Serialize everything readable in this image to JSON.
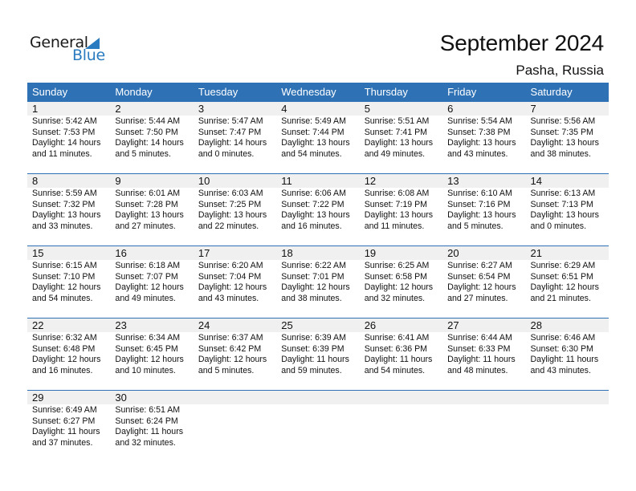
{
  "logo": {
    "general": "General",
    "blue": "Blue"
  },
  "header": {
    "title": "September 2024",
    "location": "Pasha, Russia"
  },
  "weekdays": [
    "Sunday",
    "Monday",
    "Tuesday",
    "Wednesday",
    "Thursday",
    "Friday",
    "Saturday"
  ],
  "weeks": [
    [
      {
        "day": "1",
        "sunrise": "Sunrise: 5:42 AM",
        "sunset": "Sunset: 7:53 PM",
        "daylight1": "Daylight: 14 hours",
        "daylight2": "and 11 minutes."
      },
      {
        "day": "2",
        "sunrise": "Sunrise: 5:44 AM",
        "sunset": "Sunset: 7:50 PM",
        "daylight1": "Daylight: 14 hours",
        "daylight2": "and 5 minutes."
      },
      {
        "day": "3",
        "sunrise": "Sunrise: 5:47 AM",
        "sunset": "Sunset: 7:47 PM",
        "daylight1": "Daylight: 14 hours",
        "daylight2": "and 0 minutes."
      },
      {
        "day": "4",
        "sunrise": "Sunrise: 5:49 AM",
        "sunset": "Sunset: 7:44 PM",
        "daylight1": "Daylight: 13 hours",
        "daylight2": "and 54 minutes."
      },
      {
        "day": "5",
        "sunrise": "Sunrise: 5:51 AM",
        "sunset": "Sunset: 7:41 PM",
        "daylight1": "Daylight: 13 hours",
        "daylight2": "and 49 minutes."
      },
      {
        "day": "6",
        "sunrise": "Sunrise: 5:54 AM",
        "sunset": "Sunset: 7:38 PM",
        "daylight1": "Daylight: 13 hours",
        "daylight2": "and 43 minutes."
      },
      {
        "day": "7",
        "sunrise": "Sunrise: 5:56 AM",
        "sunset": "Sunset: 7:35 PM",
        "daylight1": "Daylight: 13 hours",
        "daylight2": "and 38 minutes."
      }
    ],
    [
      {
        "day": "8",
        "sunrise": "Sunrise: 5:59 AM",
        "sunset": "Sunset: 7:32 PM",
        "daylight1": "Daylight: 13 hours",
        "daylight2": "and 33 minutes."
      },
      {
        "day": "9",
        "sunrise": "Sunrise: 6:01 AM",
        "sunset": "Sunset: 7:28 PM",
        "daylight1": "Daylight: 13 hours",
        "daylight2": "and 27 minutes."
      },
      {
        "day": "10",
        "sunrise": "Sunrise: 6:03 AM",
        "sunset": "Sunset: 7:25 PM",
        "daylight1": "Daylight: 13 hours",
        "daylight2": "and 22 minutes."
      },
      {
        "day": "11",
        "sunrise": "Sunrise: 6:06 AM",
        "sunset": "Sunset: 7:22 PM",
        "daylight1": "Daylight: 13 hours",
        "daylight2": "and 16 minutes."
      },
      {
        "day": "12",
        "sunrise": "Sunrise: 6:08 AM",
        "sunset": "Sunset: 7:19 PM",
        "daylight1": "Daylight: 13 hours",
        "daylight2": "and 11 minutes."
      },
      {
        "day": "13",
        "sunrise": "Sunrise: 6:10 AM",
        "sunset": "Sunset: 7:16 PM",
        "daylight1": "Daylight: 13 hours",
        "daylight2": "and 5 minutes."
      },
      {
        "day": "14",
        "sunrise": "Sunrise: 6:13 AM",
        "sunset": "Sunset: 7:13 PM",
        "daylight1": "Daylight: 13 hours",
        "daylight2": "and 0 minutes."
      }
    ],
    [
      {
        "day": "15",
        "sunrise": "Sunrise: 6:15 AM",
        "sunset": "Sunset: 7:10 PM",
        "daylight1": "Daylight: 12 hours",
        "daylight2": "and 54 minutes."
      },
      {
        "day": "16",
        "sunrise": "Sunrise: 6:18 AM",
        "sunset": "Sunset: 7:07 PM",
        "daylight1": "Daylight: 12 hours",
        "daylight2": "and 49 minutes."
      },
      {
        "day": "17",
        "sunrise": "Sunrise: 6:20 AM",
        "sunset": "Sunset: 7:04 PM",
        "daylight1": "Daylight: 12 hours",
        "daylight2": "and 43 minutes."
      },
      {
        "day": "18",
        "sunrise": "Sunrise: 6:22 AM",
        "sunset": "Sunset: 7:01 PM",
        "daylight1": "Daylight: 12 hours",
        "daylight2": "and 38 minutes."
      },
      {
        "day": "19",
        "sunrise": "Sunrise: 6:25 AM",
        "sunset": "Sunset: 6:58 PM",
        "daylight1": "Daylight: 12 hours",
        "daylight2": "and 32 minutes."
      },
      {
        "day": "20",
        "sunrise": "Sunrise: 6:27 AM",
        "sunset": "Sunset: 6:54 PM",
        "daylight1": "Daylight: 12 hours",
        "daylight2": "and 27 minutes."
      },
      {
        "day": "21",
        "sunrise": "Sunrise: 6:29 AM",
        "sunset": "Sunset: 6:51 PM",
        "daylight1": "Daylight: 12 hours",
        "daylight2": "and 21 minutes."
      }
    ],
    [
      {
        "day": "22",
        "sunrise": "Sunrise: 6:32 AM",
        "sunset": "Sunset: 6:48 PM",
        "daylight1": "Daylight: 12 hours",
        "daylight2": "and 16 minutes."
      },
      {
        "day": "23",
        "sunrise": "Sunrise: 6:34 AM",
        "sunset": "Sunset: 6:45 PM",
        "daylight1": "Daylight: 12 hours",
        "daylight2": "and 10 minutes."
      },
      {
        "day": "24",
        "sunrise": "Sunrise: 6:37 AM",
        "sunset": "Sunset: 6:42 PM",
        "daylight1": "Daylight: 12 hours",
        "daylight2": "and 5 minutes."
      },
      {
        "day": "25",
        "sunrise": "Sunrise: 6:39 AM",
        "sunset": "Sunset: 6:39 PM",
        "daylight1": "Daylight: 11 hours",
        "daylight2": "and 59 minutes."
      },
      {
        "day": "26",
        "sunrise": "Sunrise: 6:41 AM",
        "sunset": "Sunset: 6:36 PM",
        "daylight1": "Daylight: 11 hours",
        "daylight2": "and 54 minutes."
      },
      {
        "day": "27",
        "sunrise": "Sunrise: 6:44 AM",
        "sunset": "Sunset: 6:33 PM",
        "daylight1": "Daylight: 11 hours",
        "daylight2": "and 48 minutes."
      },
      {
        "day": "28",
        "sunrise": "Sunrise: 6:46 AM",
        "sunset": "Sunset: 6:30 PM",
        "daylight1": "Daylight: 11 hours",
        "daylight2": "and 43 minutes."
      }
    ],
    [
      {
        "day": "29",
        "sunrise": "Sunrise: 6:49 AM",
        "sunset": "Sunset: 6:27 PM",
        "daylight1": "Daylight: 11 hours",
        "daylight2": "and 37 minutes."
      },
      {
        "day": "30",
        "sunrise": "Sunrise: 6:51 AM",
        "sunset": "Sunset: 6:24 PM",
        "daylight1": "Daylight: 11 hours",
        "daylight2": "and 32 minutes."
      },
      {
        "day": "",
        "sunrise": "",
        "sunset": "",
        "daylight1": "",
        "daylight2": ""
      },
      {
        "day": "",
        "sunrise": "",
        "sunset": "",
        "daylight1": "",
        "daylight2": ""
      },
      {
        "day": "",
        "sunrise": "",
        "sunset": "",
        "daylight1": "",
        "daylight2": ""
      },
      {
        "day": "",
        "sunrise": "",
        "sunset": "",
        "daylight1": "",
        "daylight2": ""
      },
      {
        "day": "",
        "sunrise": "",
        "sunset": "",
        "daylight1": "",
        "daylight2": ""
      }
    ]
  ],
  "colors": {
    "header_bg": "#2e71b5",
    "brand_blue": "#2a7bc0",
    "day_number_bg": "#f0f0f0"
  }
}
